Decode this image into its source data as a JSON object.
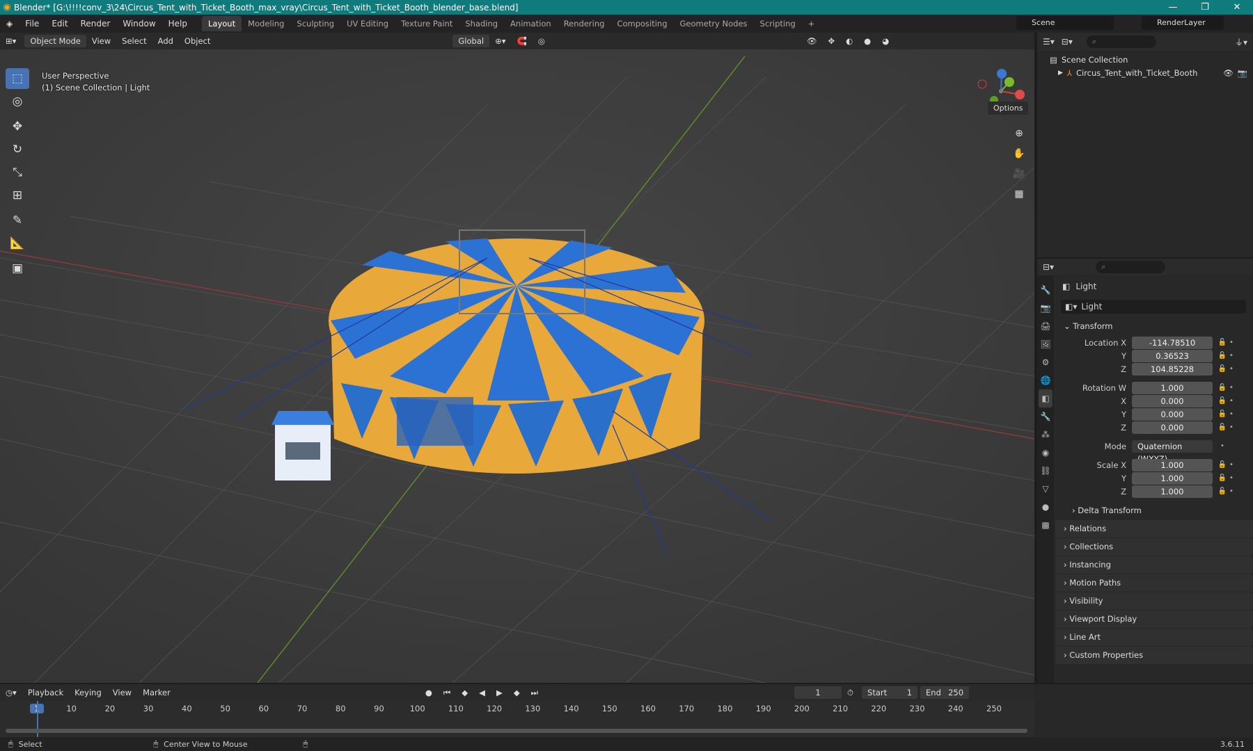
{
  "titlebar": {
    "title": "Blender* [G:\\!!!!conv_3\\24\\Circus_Tent_with_Ticket_Booth_max_vray\\Circus_Tent_with_Ticket_Booth_blender_base.blend]"
  },
  "menu": [
    "File",
    "Edit",
    "Render",
    "Window",
    "Help"
  ],
  "workspaces": [
    "Layout",
    "Modeling",
    "Sculpting",
    "UV Editing",
    "Texture Paint",
    "Shading",
    "Animation",
    "Rendering",
    "Compositing",
    "Geometry Nodes",
    "Scripting"
  ],
  "scene": "Scene",
  "render_layer": "RenderLayer",
  "vp_header": {
    "mode": "Object Mode",
    "view": "View",
    "select": "Select",
    "add": "Add",
    "object": "Object",
    "transform": "Global",
    "options": "Options"
  },
  "viewport": {
    "line1": "User Perspective",
    "line2": "(1) Scene Collection | Light"
  },
  "outliner": {
    "root": "Scene Collection",
    "item": "Circus_Tent_with_Ticket_Booth"
  },
  "props": {
    "object_name": "Light",
    "data_name": "Light",
    "transform_label": "Transform",
    "location": {
      "label_x": "Location X",
      "x": "-114.78510",
      "y": "0.36523",
      "z": "104.85228"
    },
    "rotation": {
      "label_w": "Rotation W",
      "w": "1.000",
      "x": "0.000",
      "y": "0.000",
      "z": "0.000"
    },
    "mode_label": "Mode",
    "mode": "Quaternion (WXYZ)",
    "scale": {
      "label_x": "Scale X",
      "x": "1.000",
      "y": "1.000",
      "z": "1.000"
    },
    "axis": {
      "y": "Y",
      "z": "Z",
      "x": "X"
    },
    "delta": "Delta Transform",
    "sections": [
      "Relations",
      "Collections",
      "Instancing",
      "Motion Paths",
      "Visibility",
      "Viewport Display",
      "Line Art",
      "Custom Properties"
    ]
  },
  "timeline": {
    "playback": "Playback",
    "keying": "Keying",
    "view": "View",
    "marker": "Marker",
    "current": "1",
    "start_label": "Start",
    "start": "1",
    "end_label": "End",
    "end": "250",
    "frames": [
      "1",
      "10",
      "20",
      "30",
      "40",
      "50",
      "60",
      "70",
      "80",
      "90",
      "100",
      "110",
      "120",
      "130",
      "140",
      "150",
      "160",
      "170",
      "180",
      "190",
      "200",
      "210",
      "220",
      "230",
      "240",
      "250"
    ]
  },
  "status": {
    "select": "Select",
    "center": "Center View to Mouse",
    "version": "3.6.11"
  }
}
